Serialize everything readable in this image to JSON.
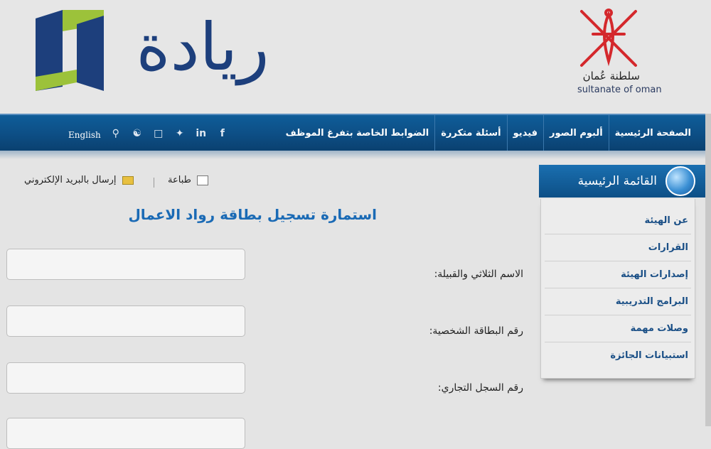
{
  "header": {
    "logo_text": "ريادة",
    "government_ar": "سلطنة عُمان",
    "government_en": "sultanate of oman"
  },
  "nav": {
    "items": [
      {
        "label": "الصفحة الرئيسية"
      },
      {
        "label": "ألبوم الصور"
      },
      {
        "label": "فيديو"
      },
      {
        "label": "أسئلة متكررة"
      },
      {
        "label": "الضوابط الخاصة بتفرغ الموظف"
      }
    ],
    "language_link": "English",
    "social_icons": [
      "search-icon",
      "share-icon",
      "skype-icon",
      "twitter-icon",
      "linkedin-icon",
      "facebook-icon"
    ]
  },
  "toolbar": {
    "print_label": "طباعة",
    "email_label": "إرسال بالبريد الإلكتروني"
  },
  "form": {
    "title": "استمارة تسجيل بطاقة رواد الاعمال",
    "fields": [
      {
        "label": "الاسم الثلاثي والقبيلة:",
        "value": ""
      },
      {
        "label": "رقم البطاقة الشخصية:",
        "value": ""
      },
      {
        "label": "رقم السجل التجاري:",
        "value": ""
      },
      {
        "label": "",
        "value": ""
      }
    ]
  },
  "sidebar": {
    "title": "القائمة الرئيسية",
    "items": [
      {
        "label": "عن الهيئة"
      },
      {
        "label": "القرارات"
      },
      {
        "label": "إصدارات الهيئة"
      },
      {
        "label": "البرامج التدريبية"
      },
      {
        "label": "وصلات مهمة"
      },
      {
        "label": "استبيانات الجائزة"
      }
    ]
  },
  "colors": {
    "navbar": "#0d4f86",
    "title_blue": "#1a6ab5",
    "sidebar_link": "#1a4f86",
    "logo_blue": "#1d3f7c",
    "logo_green": "#9cc23a",
    "emblem_red": "#d4282c"
  }
}
